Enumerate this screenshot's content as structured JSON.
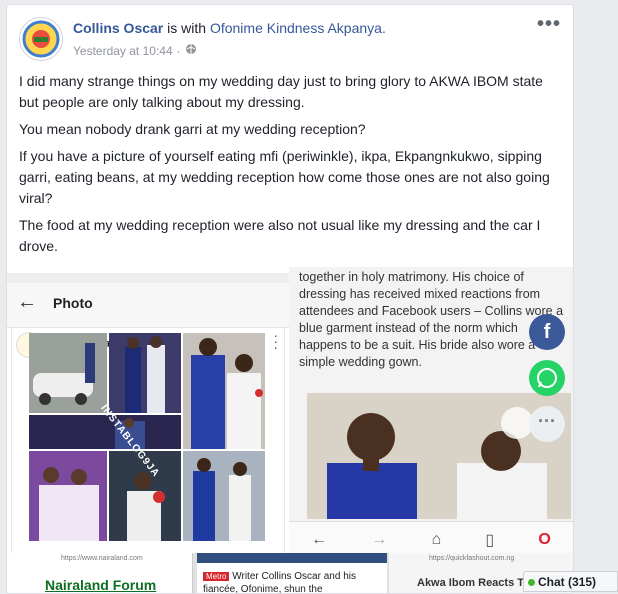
{
  "post": {
    "author": "Collins Oscar",
    "with_text": "is with",
    "tagged": "Ofonime Kindness Akpanya.",
    "timestamp": "Yesterday at 10:44",
    "separator": "·",
    "more_label": "•••",
    "paragraphs": [
      "I did many strange things on my wedding day just to bring glory to AKWA IBOM state but people are only talking about my dressing.",
      "You mean nobody drank garri at my wedding reception?",
      "If you have a picture of yourself eating mfi (periwinkle), ikpa, Ekpangnkukwo, sipping garri, eating beans, at my wedding reception how come those ones are not also going viral?",
      "The food at my wedding reception were also not usual like my dressing and the car I drove."
    ]
  },
  "left_screenshot": {
    "title": "Photo",
    "username": "instablog9ja",
    "watermark": "INSTABLOG9JA"
  },
  "right_screenshot": {
    "article_text": "together in holy matrimony. His choice of dressing has received mixed reactions from attendees and Facebook users – Collins wore a blue garment instead of the norm which happens to be a suit. His bride also wore a simple wedding gown.",
    "fb_label": "f"
  },
  "bottom_strip": {
    "nairaland_url": "https://www.nairaland.com",
    "nairaland_name": "Nairaland Forum",
    "metro_tag": "Metro",
    "metro_text": "Writer Collins Oscar and his fiancée, Ofonime, shun the",
    "qh_url": "https://quickfashout.com.ng",
    "qh_title": "Akwa Ibom Reacts To Sh"
  },
  "chat": {
    "label": "Chat (315)"
  },
  "colors": {
    "link": "#365899",
    "facebook": "#3b5998",
    "whatsapp": "#25d366"
  }
}
